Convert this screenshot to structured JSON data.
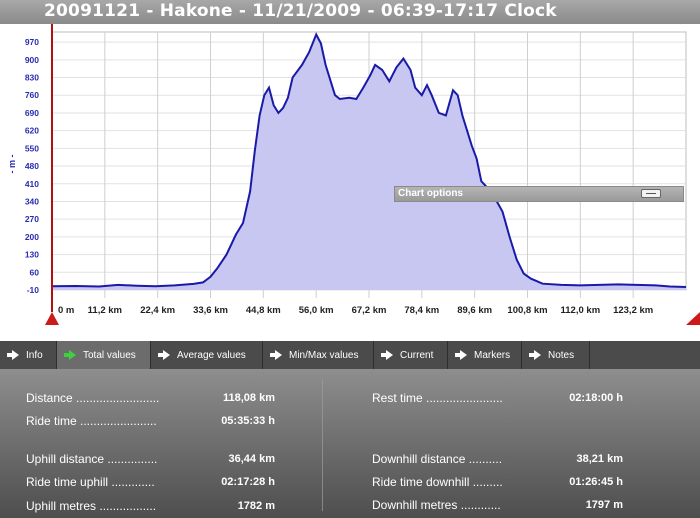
{
  "window": {
    "title": "20091121 - Hakone - 11/21/2009 - 06:39-17:17 Clock"
  },
  "chart_data": {
    "type": "area",
    "ylabel": "- m -",
    "y_ticks": [
      -10,
      60,
      130,
      200,
      270,
      340,
      410,
      480,
      550,
      620,
      690,
      760,
      830,
      900,
      970
    ],
    "ylim": [
      -10,
      1010
    ],
    "x_ticks": [
      "0 m",
      "11,2 km",
      "22,4 km",
      "33,6 km",
      "44,8 km",
      "56,0 km",
      "67,2 km",
      "78,4 km",
      "89,6 km",
      "100,8 km",
      "112,0 km",
      "123,2 km"
    ],
    "x_tick_values": [
      0,
      11.2,
      22.4,
      33.6,
      44.8,
      56.0,
      67.2,
      78.4,
      89.6,
      100.8,
      112.0,
      123.2
    ],
    "xlim": [
      0,
      134.4
    ],
    "grid": true,
    "series": [
      {
        "color": "#1a1aa8",
        "fill": "#c7c7f2",
        "points": [
          [
            0,
            5
          ],
          [
            5,
            6
          ],
          [
            10,
            4
          ],
          [
            14,
            10
          ],
          [
            18,
            7
          ],
          [
            22,
            5
          ],
          [
            26,
            8
          ],
          [
            30,
            14
          ],
          [
            32,
            20
          ],
          [
            33.6,
            42
          ],
          [
            35,
            75
          ],
          [
            37,
            130
          ],
          [
            39,
            210
          ],
          [
            40.5,
            255
          ],
          [
            42,
            380
          ],
          [
            43,
            540
          ],
          [
            44,
            680
          ],
          [
            45,
            760
          ],
          [
            46,
            790
          ],
          [
            47,
            720
          ],
          [
            48,
            690
          ],
          [
            49,
            710
          ],
          [
            50,
            750
          ],
          [
            51,
            830
          ],
          [
            53,
            880
          ],
          [
            54.5,
            930
          ],
          [
            56,
            1000
          ],
          [
            57,
            965
          ],
          [
            58,
            880
          ],
          [
            59,
            820
          ],
          [
            60,
            760
          ],
          [
            61,
            745
          ],
          [
            63,
            750
          ],
          [
            64.5,
            745
          ],
          [
            66,
            790
          ],
          [
            67.5,
            840
          ],
          [
            68.5,
            880
          ],
          [
            70,
            860
          ],
          [
            71.5,
            815
          ],
          [
            73,
            870
          ],
          [
            74.5,
            905
          ],
          [
            76,
            860
          ],
          [
            77,
            790
          ],
          [
            78.4,
            760
          ],
          [
            79.5,
            800
          ],
          [
            80.5,
            760
          ],
          [
            82,
            690
          ],
          [
            83.5,
            680
          ],
          [
            85,
            780
          ],
          [
            86,
            760
          ],
          [
            87,
            680
          ],
          [
            88,
            620
          ],
          [
            89,
            560
          ],
          [
            90,
            510
          ],
          [
            91,
            420
          ],
          [
            92,
            400
          ],
          [
            94,
            350
          ],
          [
            95.5,
            300
          ],
          [
            97,
            200
          ],
          [
            98.5,
            110
          ],
          [
            100,
            55
          ],
          [
            101.5,
            35
          ],
          [
            104,
            15
          ],
          [
            108,
            10
          ],
          [
            112,
            8
          ],
          [
            116,
            10
          ],
          [
            120,
            12
          ],
          [
            124,
            10
          ],
          [
            128,
            8
          ],
          [
            131,
            4
          ],
          [
            134.4,
            2
          ]
        ]
      }
    ]
  },
  "chart_options": {
    "label": "Chart options"
  },
  "tabs": [
    {
      "label": "Info",
      "active": false,
      "arrow": false
    },
    {
      "label": "Total values",
      "active": true,
      "arrow": true,
      "arrow_color": "#3ed13e"
    },
    {
      "label": "Average values",
      "active": false,
      "arrow": true
    },
    {
      "label": "Min/Max values",
      "active": false,
      "arrow": true
    },
    {
      "label": "Current",
      "active": false,
      "arrow": true
    },
    {
      "label": "Markers",
      "active": false,
      "arrow": true
    },
    {
      "label": "Notes",
      "active": false,
      "arrow": true
    }
  ],
  "stats": {
    "distance": {
      "label": "Distance .........................",
      "value": "118,08 km"
    },
    "ride_time": {
      "label": "Ride time .......................",
      "value": "05:35:33 h"
    },
    "rest_time": {
      "label": "Rest time .......................",
      "value": "02:18:00 h"
    },
    "uphill_distance": {
      "label": "Uphill distance ...............",
      "value": "36,44 km"
    },
    "ride_time_uphill": {
      "label": "Ride time uphill .............",
      "value": "02:17:28 h"
    },
    "uphill_metres": {
      "label": "Uphill metres .................",
      "value": "1782 m"
    },
    "downhill_distance": {
      "label": "Downhill distance ..........",
      "value": "38,21 km"
    },
    "ride_time_downhill": {
      "label": "Ride time downhill .........",
      "value": "01:26:45 h"
    },
    "downhill_metres": {
      "label": "Downhill metres ............",
      "value": "1797 m"
    }
  }
}
